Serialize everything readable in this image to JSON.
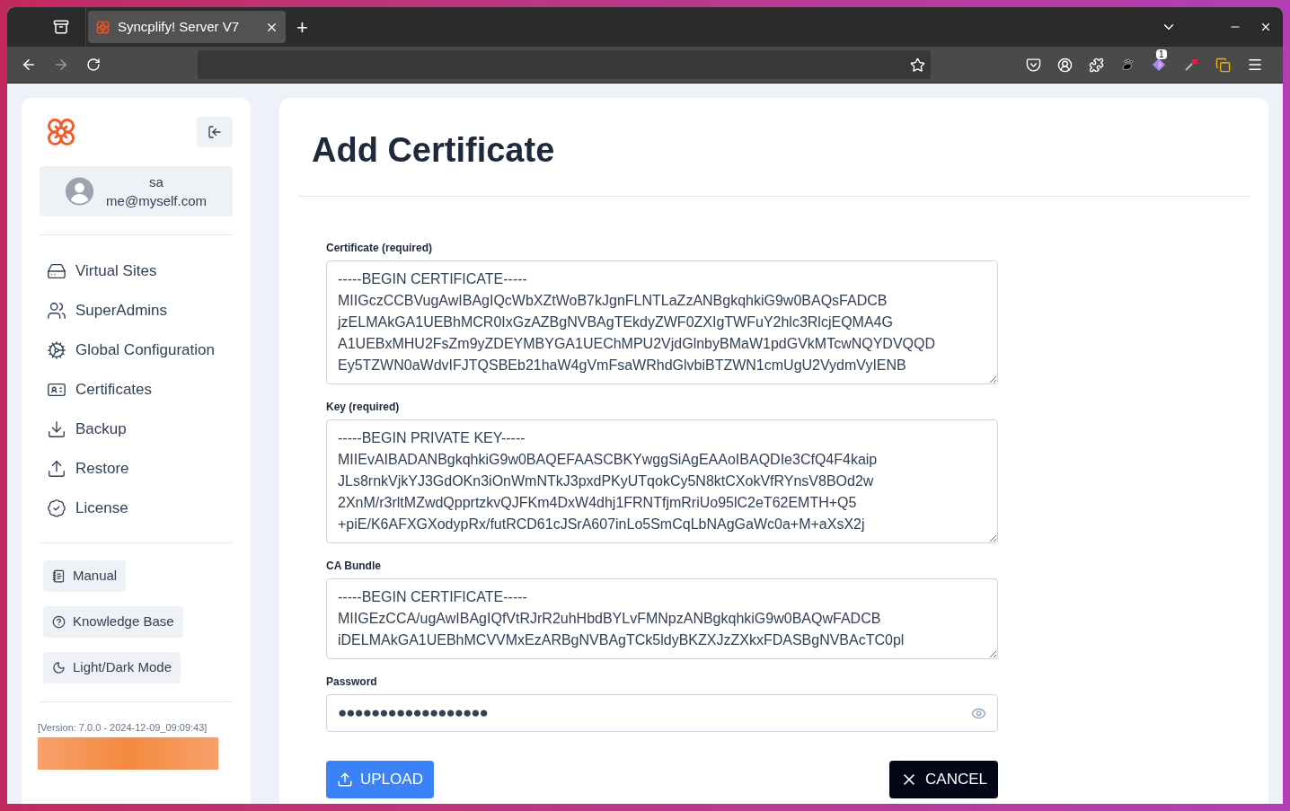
{
  "browser": {
    "tab_title": "Syncplify! Server V7",
    "new_tab": "+",
    "badge": "1"
  },
  "sidebar": {
    "user": {
      "name": "sa",
      "email": "me@myself.com"
    },
    "nav": [
      {
        "kind": "sites",
        "label": "Virtual Sites"
      },
      {
        "kind": "admins",
        "label": "SuperAdmins"
      },
      {
        "kind": "config",
        "label": "Global Configuration"
      },
      {
        "kind": "certs",
        "label": "Certificates"
      },
      {
        "kind": "backup",
        "label": "Backup"
      },
      {
        "kind": "restore",
        "label": "Restore"
      },
      {
        "kind": "license",
        "label": "License"
      }
    ],
    "links": [
      {
        "kind": "manual",
        "label": "Manual"
      },
      {
        "kind": "kb",
        "label": "Knowledge Base"
      },
      {
        "kind": "mode",
        "label": "Light/Dark Mode"
      }
    ],
    "version": "[Version: 7.0.0 - 2024-12-09_09:09:43]"
  },
  "page": {
    "title": "Add Certificate",
    "fields": [
      {
        "label": "Certificate (required)",
        "lines": [
          "-----BEGIN CERTIFICATE-----",
          "MIIGczCCBVugAwIBAgIQcWbXZtWoB7kJgnFLNTLaZzANBgkqhkiG9w0BAQsFADCB",
          "jzELMAkGA1UEBhMCR0IxGzAZBgNVBAgTEkdyZWF0ZXIgTWFuY2hlc3RlcjEQMA4G",
          "A1UEBxMHU2FsZm9yZDEYMBYGA1UEChMPU2VjdGlnbyBMaW1pdGVkMTcwNQYDVQQD",
          "Ey5TZWN0aWdvIFJTQSBEb21haW4gVmFsaWRhdGlvbiBTZWN1cmUgU2VydmVyIENB"
        ]
      },
      {
        "label": "Key (required)",
        "lines": [
          "-----BEGIN PRIVATE KEY-----",
          "MIIEvAIBADANBgkqhkiG9w0BAQEFAASCBKYwggSiAgEAAoIBAQDIe3CfQ4F4kaip",
          "JLs8rnkVjkYJ3GdOKn3iOnWmNTkJ3pxdPKyUTqokCy5N8ktCXokVfRYnsV8BOd2w",
          "2XnM/r3rltMZwdQpprtzkvQJFKm4DxW4dhj1FRNTfjmRriUo95lC2eT62EMTH+Q5",
          "+piE/K6AFXGXodypRx/futRCD61cJSrA607inLo5SmCqLbNAgGaWc0a+M+aXsX2j"
        ]
      },
      {
        "label": "CA Bundle",
        "lines": [
          "-----BEGIN CERTIFICATE-----",
          "MIIGEzCCA/ugAwIBAgIQfVtRJrR2uhHbdBYLvFMNpzANBgkqhkiG9w0BAQwFADCB",
          "iDELMAkGA1UEBhMCVVMxEzARBgNVBAgTCk5ldyBKZXJzZXkxFDASBgNVBAcTC0pl"
        ]
      }
    ],
    "password": {
      "label": "Password",
      "value": "●●●●●●●●●●●●●●●●●●"
    },
    "buttons": [
      {
        "kind": "upload",
        "label": "UPLOAD"
      },
      {
        "kind": "cancel",
        "label": "CANCEL"
      }
    ]
  }
}
